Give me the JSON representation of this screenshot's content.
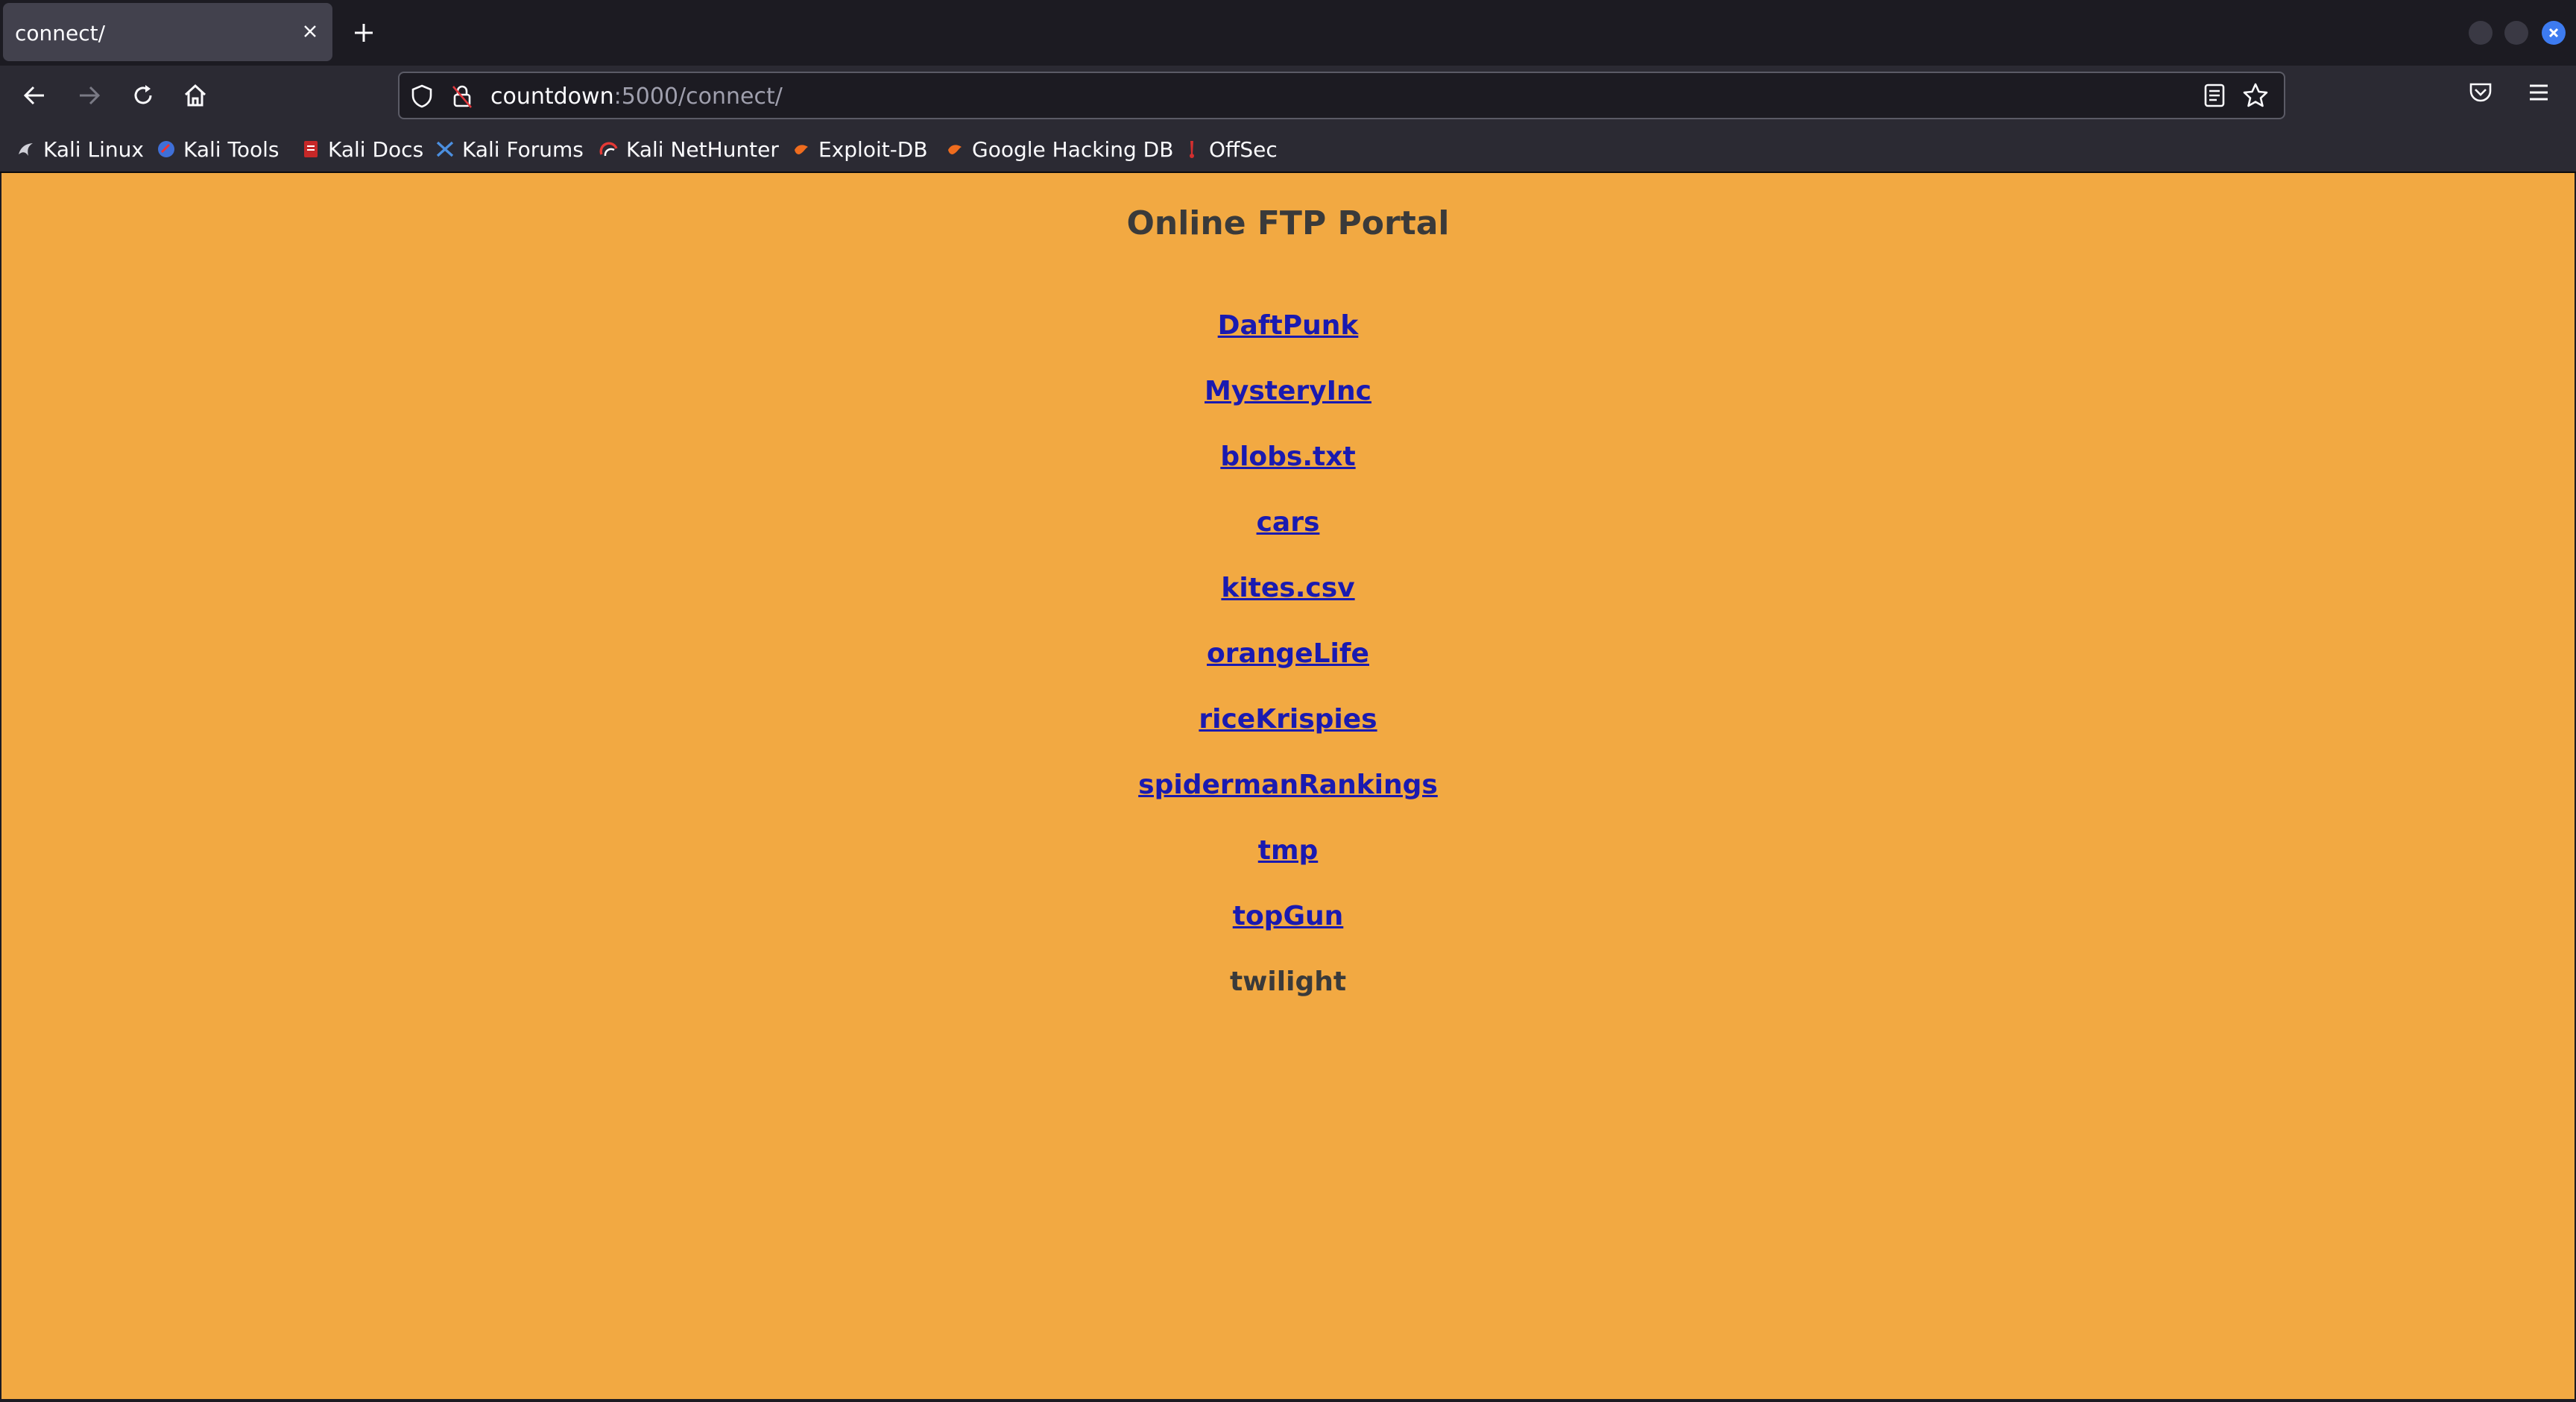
{
  "browser": {
    "tab": {
      "title": "connect/"
    },
    "url": {
      "host": "countdown",
      "path": ":5000/connect/"
    },
    "bookmarks": [
      {
        "label": "Kali Linux",
        "icon": "kali-dragon-icon"
      },
      {
        "label": "Kali Tools",
        "icon": "kali-tools-icon"
      },
      {
        "label": "Kali Docs",
        "icon": "kali-docs-icon"
      },
      {
        "label": "Kali Forums",
        "icon": "kali-forums-icon"
      },
      {
        "label": "Kali NetHunter",
        "icon": "nethunter-icon"
      },
      {
        "label": "Exploit-DB",
        "icon": "exploit-db-icon"
      },
      {
        "label": "Google Hacking DB",
        "icon": "ghdb-icon"
      },
      {
        "label": "OffSec",
        "icon": "offsec-icon"
      }
    ]
  },
  "page": {
    "title": "Online FTP Portal",
    "background": "#f2a942",
    "link_color": "#1a1ab0",
    "items": [
      {
        "label": "DaftPunk",
        "link": true
      },
      {
        "label": "MysteryInc",
        "link": true
      },
      {
        "label": "blobs.txt",
        "link": true
      },
      {
        "label": "cars",
        "link": true
      },
      {
        "label": "kites.csv",
        "link": true
      },
      {
        "label": "orangeLife",
        "link": true
      },
      {
        "label": "riceKrispies",
        "link": true
      },
      {
        "label": "spidermanRankings",
        "link": true
      },
      {
        "label": "tmp",
        "link": true
      },
      {
        "label": "topGun",
        "link": true
      },
      {
        "label": "twilight",
        "link": false
      }
    ]
  }
}
